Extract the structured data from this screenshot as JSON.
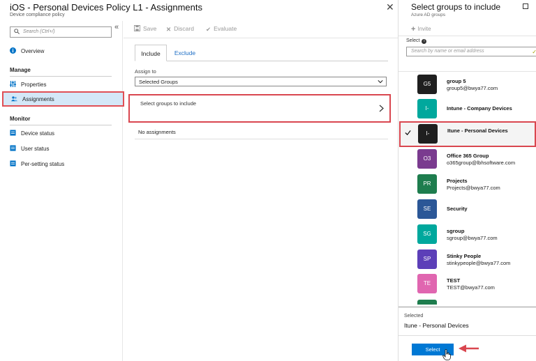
{
  "header": {
    "title": "iOS - Personal Devices Policy L1 - Assignments",
    "subtitle": "Device compliance policy"
  },
  "nav": {
    "search_placeholder": "Search (Ctrl+/)",
    "overview": "Overview",
    "manage_section": "Manage",
    "properties": "Properties",
    "assignments": "Assignments",
    "monitor_section": "Monitor",
    "device_status": "Device status",
    "user_status": "User status",
    "per_setting_status": "Per-setting status"
  },
  "toolbar": {
    "save": "Save",
    "discard": "Discard",
    "evaluate": "Evaluate"
  },
  "tabs": {
    "include": "Include",
    "exclude": "Exclude"
  },
  "assign": {
    "label": "Assign to",
    "value": "Selected Groups",
    "select_groups": "Select groups to include",
    "empty": "No assignments"
  },
  "right_pane": {
    "title": "Select groups to include",
    "subtitle": "Azure AD groups",
    "invite": "Invite",
    "select_label": "Select",
    "search_placeholder": "Search by name or email address",
    "groups": [
      {
        "initials": "G5",
        "name": "group 5",
        "email": "group5@bwya77.com",
        "color": "#1f1f1f"
      },
      {
        "initials": "I-",
        "name": "Intune - Company Devices",
        "email": "",
        "color": "#00a89d"
      },
      {
        "initials": "I-",
        "name": "Itune - Personal Devices",
        "email": "",
        "color": "#1f1f1f",
        "selected": true
      },
      {
        "initials": "O3",
        "name": "Office 365 Group",
        "email": "o365group@lbhsoftware.com",
        "color": "#7a3b8f"
      },
      {
        "initials": "PR",
        "name": "Projects",
        "email": "Projects@bwya77.com",
        "color": "#1e7d4e"
      },
      {
        "initials": "SE",
        "name": "Security",
        "email": "",
        "color": "#2b5797"
      },
      {
        "initials": "SG",
        "name": "sgroup",
        "email": "sgroup@bwya77.com",
        "color": "#00a89d"
      },
      {
        "initials": "SP",
        "name": "Stinky People",
        "email": "stinkypeople@bwya77.com",
        "color": "#5c3fb8"
      },
      {
        "initials": "TE",
        "name": "TEST",
        "email": "TEST@bwya77.com",
        "color": "#e066b0"
      }
    ],
    "selected_label": "Selected",
    "selected_value": "Itune - Personal Devices",
    "select_button": "Select"
  }
}
